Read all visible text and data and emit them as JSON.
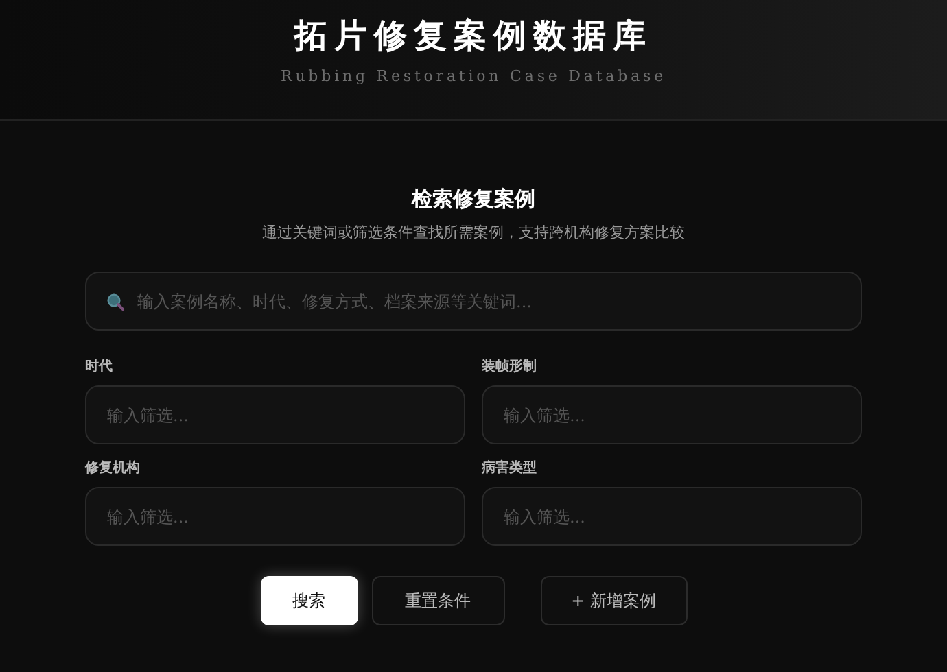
{
  "header": {
    "title": "拓片修复案例数据库",
    "subtitle": "Rubbing Restoration Case Database"
  },
  "search_section": {
    "title": "检索修复案例",
    "description": "通过关键词或筛选条件查找所需案例，支持跨机构修复方案比较",
    "search": {
      "placeholder": "输入案例名称、时代、修复方式、档案来源等关键词..."
    },
    "filters": [
      {
        "label": "时代",
        "placeholder": "输入筛选..."
      },
      {
        "label": "装帧形制",
        "placeholder": "输入筛选..."
      },
      {
        "label": "修复机构",
        "placeholder": "输入筛选..."
      },
      {
        "label": "病害类型",
        "placeholder": "输入筛选..."
      }
    ],
    "buttons": [
      {
        "label": "搜索",
        "kind": "primary"
      },
      {
        "label": "重置条件",
        "kind": "secondary"
      },
      {
        "label": "+ 新增案例",
        "kind": "add"
      }
    ]
  }
}
